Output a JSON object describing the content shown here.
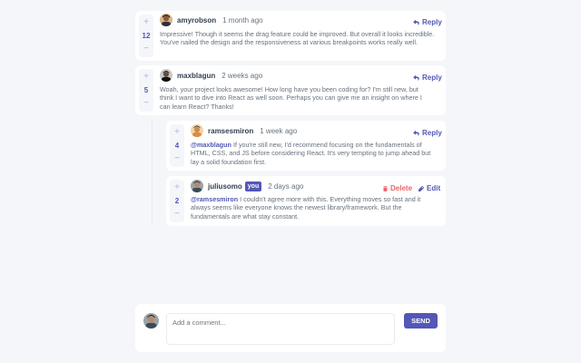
{
  "comments": [
    {
      "username": "amyrobson",
      "date": "1 month ago",
      "score": "12",
      "action": "Reply",
      "text": "Impressive! Though it seems the drag feature could be improved. But overall it looks incredible. You've nailed the design and the responsiveness at various breakpoints works really well."
    },
    {
      "username": "maxblagun",
      "date": "2 weeks ago",
      "score": "5",
      "action": "Reply",
      "text": "Woah, your project looks awesome! How long have you been coding for? I'm still new, but think I want to dive into React as well soon. Perhaps you can give me an insight on where I can learn React? Thanks!"
    }
  ],
  "replies": [
    {
      "username": "ramsesmiron",
      "date": "1 week ago",
      "score": "4",
      "action": "Reply",
      "mention": "@maxblagun",
      "text": " If you're still new, I'd recommend focusing on the fundamentals of HTML, CSS, and JS before considering React. It's very tempting to jump ahead but lay a solid foundation first."
    },
    {
      "username": "juliusomo",
      "badge": "you",
      "date": "2 days ago",
      "score": "2",
      "delete_label": "Delete",
      "edit_label": "Edit",
      "mention": "@ramsesmiron",
      "text": " I couldn't agree more with this. Everything moves so fast and it always seems like everyone knows the newest library/framework. But the fundamentals are what stay constant."
    }
  ],
  "vote": {
    "plus": "+",
    "minus": "−"
  },
  "compose": {
    "placeholder": "Add a comment...",
    "send_label": "SEND"
  },
  "colors": {
    "accent": "#5357b6",
    "danger": "#ed6368",
    "background": "#f5f6fa",
    "card": "#ffffff",
    "heading": "#324152",
    "body": "#67727e"
  },
  "icons": {
    "reply": "reply-arrow-icon",
    "delete": "trash-icon",
    "edit": "pencil-icon"
  }
}
